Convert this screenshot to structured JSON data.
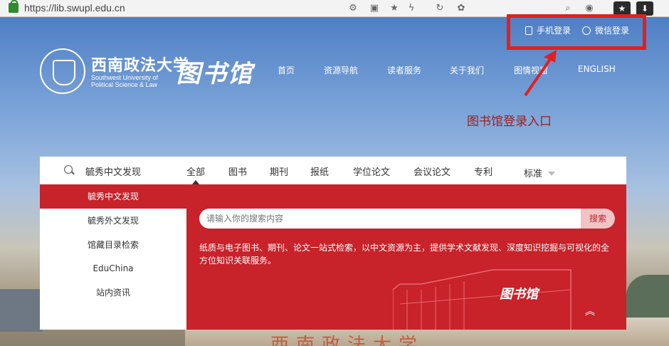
{
  "browser": {
    "url": "https://lib.swupl.edu.cn"
  },
  "header": {
    "university_cn": "西南政法大学",
    "university_en_line1": "Southwest University of",
    "university_en_line2": "Political Science & Law",
    "library_title": "图书馆",
    "login": {
      "phone_label": "手机登录",
      "wechat_label": "微信登录"
    },
    "nav": [
      "首页",
      "资源导航",
      "读者服务",
      "关于我们",
      "图情视窗",
      "ENGLISH"
    ]
  },
  "annotation": {
    "caption": "图书馆登录入口",
    "highlight_color": "#e02020"
  },
  "search": {
    "current_source": "毓秀中文发现",
    "tabs": [
      "全部",
      "图书",
      "期刊",
      "报纸",
      "学位论文",
      "会议论文",
      "专利"
    ],
    "active_tab": "全部",
    "select_value": "标准",
    "sources": [
      "毓秀中文发现",
      "毓秀外文发现",
      "馆藏目录检索",
      "EduChina",
      "站内资讯"
    ],
    "placeholder": "请输入你的搜索内容",
    "button_label": "搜索",
    "description": "纸质与电子图书、期刊、论文一站式检索，以中文资源为主，提供学术文献发现、深度知识挖掘与可视化的全方位知识关联服务。",
    "panel_library_mark": "图书馆",
    "accent_color": "#c8222a"
  },
  "footer_rock_text": "西南政法大学"
}
